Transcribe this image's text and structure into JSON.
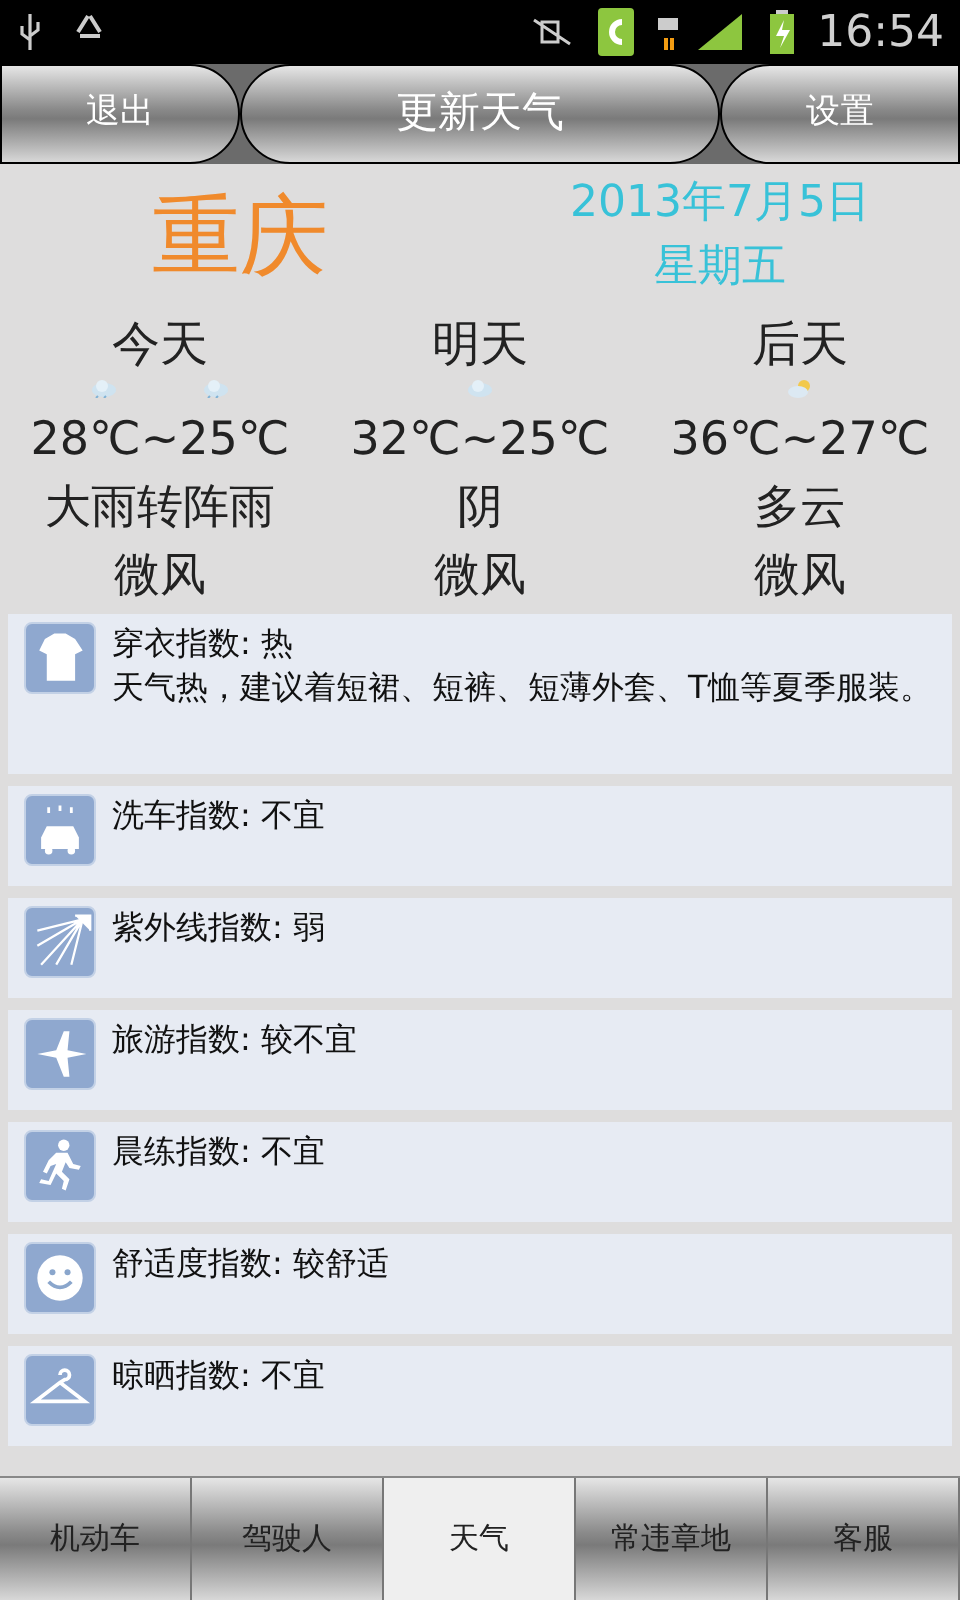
{
  "status_bar": {
    "time": "16:54"
  },
  "toolbar": {
    "left_button": "退出",
    "title_button": "更新天气",
    "right_button": "设置"
  },
  "header": {
    "city": "重庆",
    "date": "2013年7月5日",
    "weekday": "星期五"
  },
  "forecast": [
    {
      "day": "今天",
      "weather_icons": [
        {
          "kind": "rain"
        },
        {
          "kind": "rain"
        }
      ],
      "temperature": "28℃~25℃",
      "condition": "大雨转阵雨",
      "wind": "微风"
    },
    {
      "day": "明天",
      "weather_icons": [
        {
          "kind": "cloud"
        }
      ],
      "temperature": "32℃~25℃",
      "condition": "阴",
      "wind": "微风"
    },
    {
      "day": "后天",
      "weather_icons": [
        {
          "kind": "sun_cloud"
        }
      ],
      "temperature": "36℃~27℃",
      "condition": "多云",
      "wind": "微风"
    }
  ],
  "indices": [
    {
      "kind": "shirt",
      "title": "穿衣指数: 热",
      "description": "天气热，建议着短裙、短裤、短薄外套、T恤等夏季服装。"
    },
    {
      "kind": "car",
      "title": "洗车指数: 不宜"
    },
    {
      "kind": "sun",
      "title": "紫外线指数: 弱"
    },
    {
      "kind": "plane",
      "title": "旅游指数: 较不宜"
    },
    {
      "kind": "runner",
      "title": "晨练指数: 不宜"
    },
    {
      "kind": "smile",
      "title": "舒适度指数: 较舒适"
    },
    {
      "kind": "hanger",
      "title": "晾晒指数: 不宜"
    }
  ],
  "tabs": [
    {
      "label": "机动车",
      "selected": false
    },
    {
      "label": "驾驶人",
      "selected": false
    },
    {
      "label": "天气",
      "selected": true
    },
    {
      "label": "常违章地",
      "selected": false
    },
    {
      "label": "客服",
      "selected": false
    }
  ]
}
